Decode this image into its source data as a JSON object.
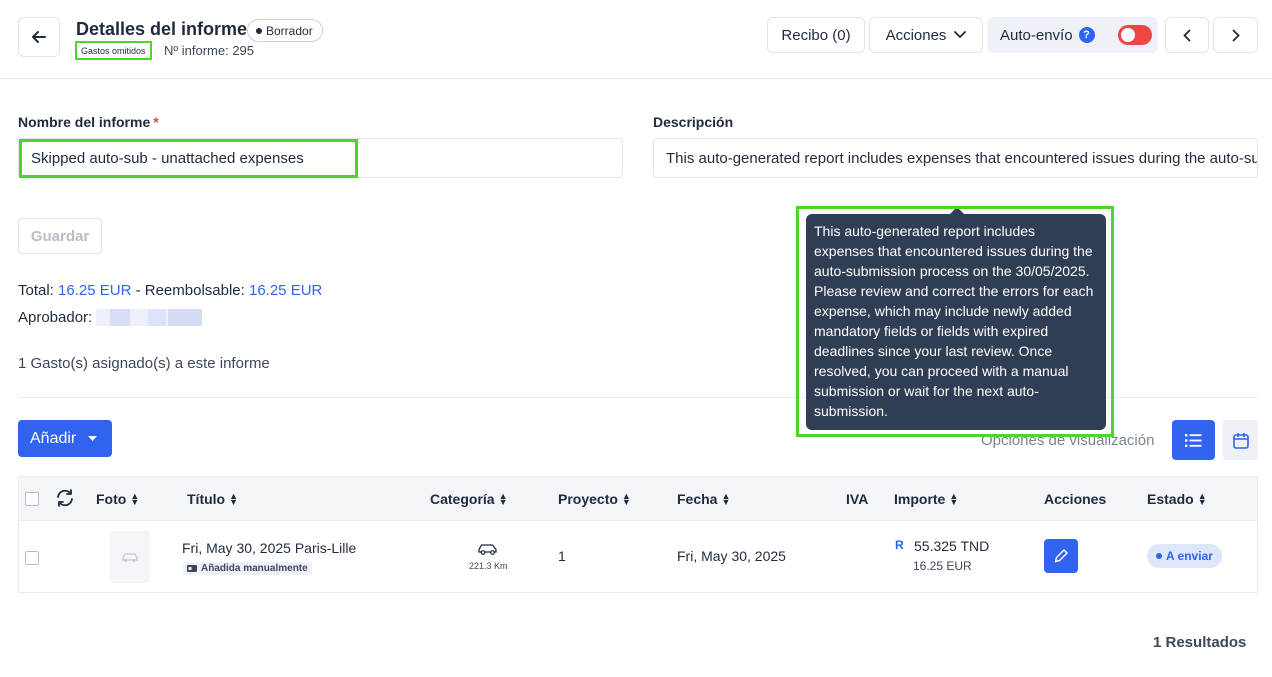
{
  "header": {
    "title": "Detalles del informe",
    "status": "Borrador",
    "omitted_tag": "Gastos omitidos",
    "report_number": "Nº informe: 295",
    "receipt_button": "Recibo (0)",
    "actions_button": "Acciones",
    "autosend_label": "Auto-envío",
    "help_glyph": "?",
    "autosend_enabled": false
  },
  "form": {
    "name_label": "Nombre del informe",
    "required_mark": "*",
    "name_value": "Skipped auto-sub - unattached expenses",
    "description_label": "Descripción",
    "description_value": "This auto-generated report includes expenses that encountered issues during the auto-submission process on the 30/05/2025.",
    "save_button": "Guardar"
  },
  "summary": {
    "total_label": "Total:",
    "total_value": "16.25 EUR",
    "separator": "-",
    "reimbursable_label": "Reembolsable:",
    "reimbursable_value": "16.25 EUR",
    "approver_label": "Aprobador:",
    "assigned_text": "1 Gasto(s) asignado(s) a este informe"
  },
  "toolbar": {
    "add_button": "Añadir",
    "view_options_label": "Opciones de visualización"
  },
  "table": {
    "columns": {
      "photo": "Foto",
      "title": "Título",
      "category": "Categoría",
      "project": "Proyecto",
      "date": "Fecha",
      "vat": "IVA",
      "amount": "Importe",
      "actions": "Acciones",
      "state": "Estado"
    },
    "rows": [
      {
        "title": "Fri, May 30, 2025 Paris-Lille",
        "tag": "Añadida manualmente",
        "category_sub": "221.3 Km",
        "project": "1",
        "date": "Fri, May 30, 2025",
        "amount_marker": "R",
        "amount": "55.325 TND",
        "amount_converted": "16.25 EUR",
        "state": "A enviar"
      }
    ]
  },
  "results": "1 Resultados",
  "tooltip": {
    "text": "This auto-generated report includes expenses that encountered issues during the auto-submission process on the 30/05/2025. Please review and correct the errors for each expense, which may include newly added mandatory fields or fields with expired deadlines since your last review. Once resolved, you can proceed with a manual submission or wait for the next auto-submission."
  },
  "colors": {
    "accent": "#2f63f0",
    "highlight": "#4cd62b",
    "toggle_off": "#ef4545",
    "tooltip_bg": "#2f3e55"
  },
  "icons": [
    "back-arrow-icon",
    "chevron-down-icon",
    "help-icon",
    "chevron-left-icon",
    "chevron-right-icon",
    "caret-down-icon",
    "list-view-icon",
    "calendar-icon",
    "refresh-icon",
    "car-icon",
    "id-card-icon",
    "pencil-icon"
  ]
}
